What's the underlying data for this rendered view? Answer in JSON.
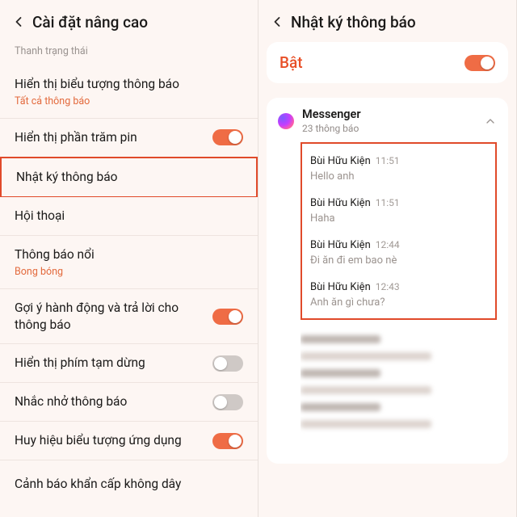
{
  "left": {
    "title": "Cài đặt nâng cao",
    "section": "Thanh trạng thái",
    "rows": {
      "r0": {
        "title": "Hiển thị biểu tượng thông báo",
        "sub": "Tất cả thông báo"
      },
      "r1": {
        "title": "Hiển thị phần trăm pin"
      },
      "r2": {
        "title": "Nhật ký thông báo"
      },
      "r3": {
        "title": "Hội thoại"
      },
      "r4": {
        "title": "Thông báo nổi",
        "sub": "Bong bóng"
      },
      "r5": {
        "title": "Gợi ý hành động và trả lời cho thông báo"
      },
      "r6": {
        "title": "Hiển thị phím tạm dừng"
      },
      "r7": {
        "title": "Nhắc nhở thông báo"
      },
      "r8": {
        "title": "Huy hiệu biểu tượng ứng dụng"
      },
      "r9": {
        "title": "Cảnh báo khẩn cấp không dây"
      }
    }
  },
  "right": {
    "title": "Nhật ký thông báo",
    "on_label": "Bật",
    "app": {
      "name": "Messenger",
      "sub": "23 thông báo"
    },
    "notifs": {
      "n0": {
        "sender": "Bùi Hữu Kiện",
        "time": "11:51",
        "body": "Hello anh"
      },
      "n1": {
        "sender": "Bùi Hữu Kiện",
        "time": "11:51",
        "body": "Haha"
      },
      "n2": {
        "sender": "Bùi Hữu Kiện",
        "time": "12:44",
        "body": "Đi ăn đi em bao nè"
      },
      "n3": {
        "sender": "Bùi Hữu Kiện",
        "time": "12:43",
        "body": "Anh ăn gì chưa?"
      }
    }
  }
}
